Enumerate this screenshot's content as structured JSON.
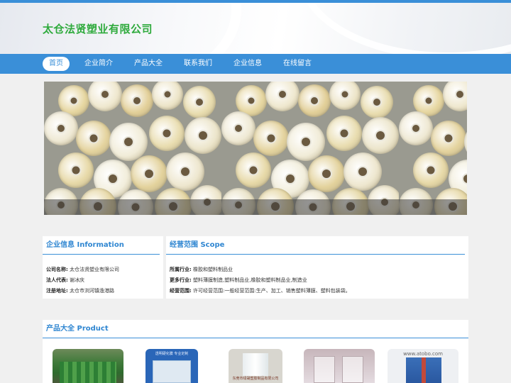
{
  "header": {
    "site_title": "太仓法贤塑业有限公司"
  },
  "nav": {
    "items": [
      {
        "label": "首页",
        "active": true
      },
      {
        "label": "企业简介",
        "active": false
      },
      {
        "label": "产品大全",
        "active": false
      },
      {
        "label": "联系我们",
        "active": false
      },
      {
        "label": "企业信息",
        "active": false
      },
      {
        "label": "在线留言",
        "active": false
      }
    ]
  },
  "info": {
    "title_cn": "企业信息",
    "title_en": "Information",
    "rows": [
      {
        "label": "公司名称:",
        "value": "太仓法贤塑业有限公司"
      },
      {
        "label": "法人代表:",
        "value": "谢冰庆"
      },
      {
        "label": "注册地址:",
        "value": "太仓市浏河镇渔港路"
      }
    ]
  },
  "scope": {
    "title_cn": "经营范围",
    "title_en": "Scope",
    "rows": [
      {
        "label": "所属行业:",
        "value": "橡胶和塑料制品业"
      },
      {
        "label": "更多行业:",
        "value": "塑料薄膜制造,塑料制品业,橡胶和塑料制品业,制造业"
      },
      {
        "label": "经营范围:",
        "value": "许可经营范围:一般经营范围:生产、加工、销售塑料薄膜、塑料包装袋。"
      }
    ]
  },
  "products": {
    "title_cn": "产品大全",
    "title_en": "Product",
    "items": [
      {
        "image_caption": ""
      },
      {
        "image_caption": "透明硬化膜 专业定制"
      },
      {
        "image_caption": "东莞市绿晟塑胶制品有限公司"
      },
      {
        "image_caption": ""
      },
      {
        "image_caption": "www.atobo.com"
      }
    ]
  },
  "colors": {
    "accent": "#3a8fd8",
    "title_green": "#2eaa3c"
  }
}
